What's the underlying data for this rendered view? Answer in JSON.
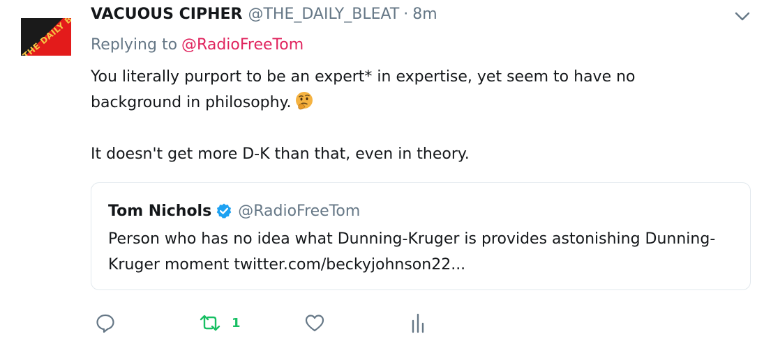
{
  "tweet": {
    "display_name": "VACUOUS CIPHER",
    "handle": "@THE_DAILY_BLEAT",
    "separator": "·",
    "time": "8m",
    "avatar_text": "THE DAILY BLEAT",
    "replying_label": "Replying to",
    "replying_mention": "@RadioFreeTom",
    "text_line1": "You literally purport to be an expert* in expertise, yet seem to have no background in philosophy.",
    "emoji_icon": "thinking-face-icon",
    "text_line2": "It doesn't get more D-K than that, even in theory."
  },
  "quote": {
    "display_name": "Tom Nichols",
    "verified_icon": "verified-badge-icon",
    "handle": "@RadioFreeTom",
    "text": "Person who has no idea what Dunning-Kruger is provides astonishing Dunning-Kruger moment twitter.com/beckyjohnson22..."
  },
  "actions": {
    "reply_icon": "reply-icon",
    "retweet_icon": "retweet-icon",
    "retweet_count": "1",
    "like_icon": "heart-icon",
    "analytics_icon": "analytics-icon"
  },
  "colors": {
    "mention": "#e0245e",
    "secondary_text": "#657786",
    "retweet_active": "#17bf63",
    "verified": "#1da1f2",
    "border": "#e1e8ed"
  }
}
